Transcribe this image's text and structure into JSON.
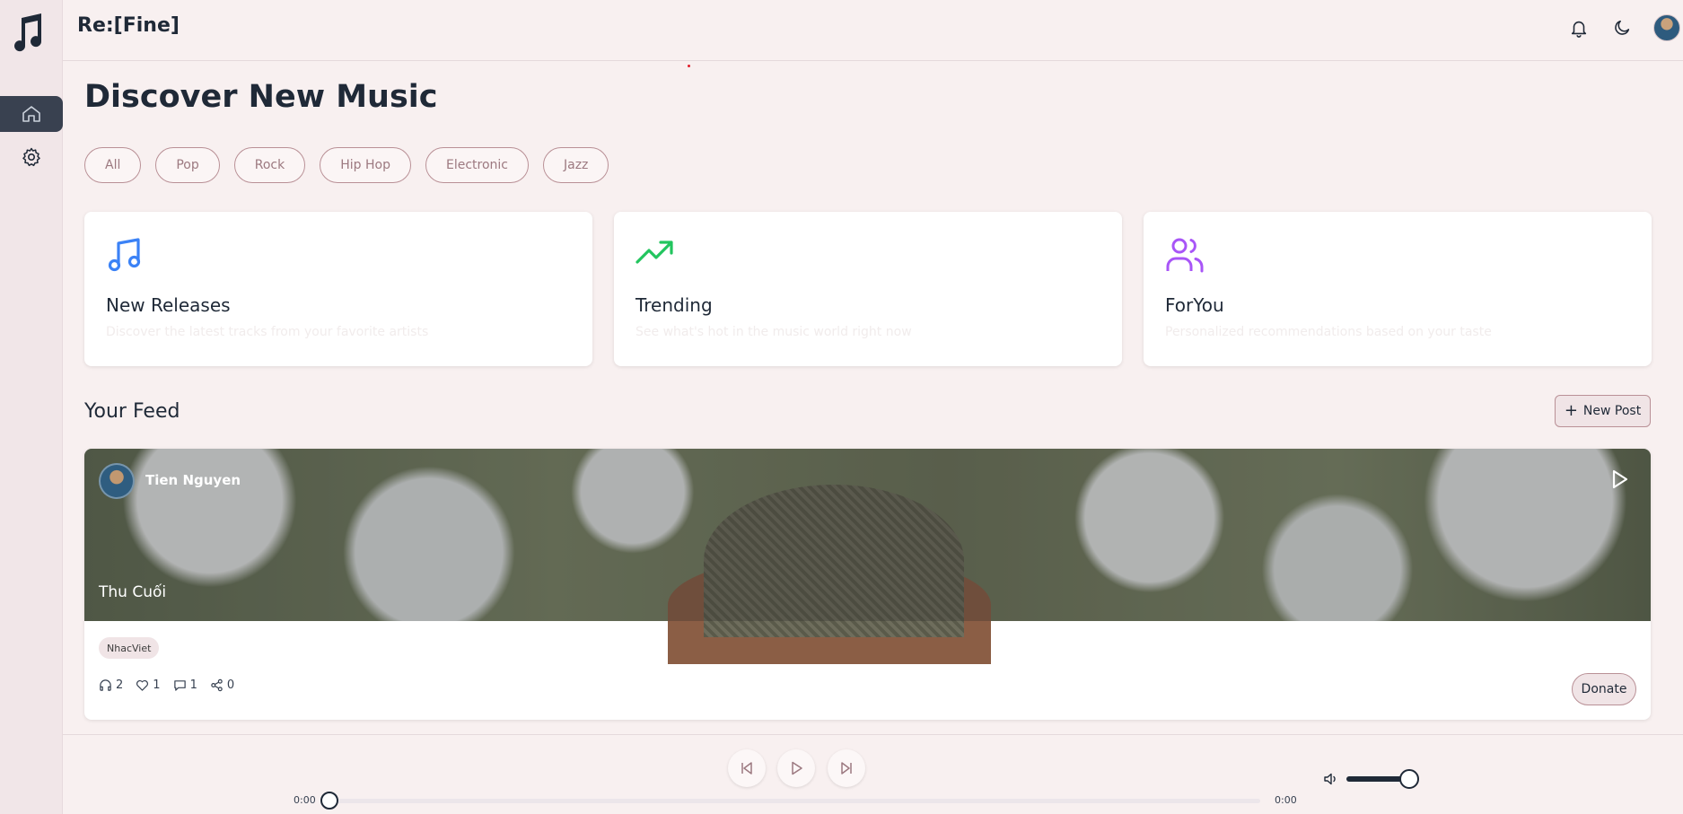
{
  "app": {
    "brand": "Re:[Fine]"
  },
  "sidebar": {
    "items": [
      {
        "name": "home",
        "icon": "home-icon"
      },
      {
        "name": "settings",
        "icon": "gear-icon"
      }
    ]
  },
  "header": {
    "icons": [
      "bell-icon",
      "moon-icon"
    ]
  },
  "page": {
    "title": "Discover New Music"
  },
  "genres": [
    "All",
    "Pop",
    "Rock",
    "Hip Hop",
    "Electronic",
    "Jazz"
  ],
  "cards": [
    {
      "title": "New Releases",
      "description": "Discover the latest tracks from your favorite artists",
      "icon": "music-note-icon",
      "color": "#3b82f6"
    },
    {
      "title": "Trending",
      "description": "See what's hot in the music world right now",
      "icon": "trending-up-icon",
      "color": "#22c55e"
    },
    {
      "title": "ForYou",
      "description": "Personalized recommendations based on your taste",
      "icon": "users-icon",
      "color": "#a855f7"
    }
  ],
  "feed": {
    "title": "Your Feed",
    "new_post_label": "New Post",
    "post": {
      "author": "Tien Nguyen",
      "song": "Thu Cuối",
      "tag": "NhacViet",
      "listens": "2",
      "likes": "1",
      "comments": "1",
      "shares": "0",
      "donate_label": "Donate"
    }
  },
  "player": {
    "current_time": "0:00",
    "duration": "0:00",
    "progress": 0,
    "volume": 1.0
  },
  "colors": {
    "accent": "#b99096",
    "sidebar_active": "#394150",
    "background": "#f8f0f0"
  }
}
